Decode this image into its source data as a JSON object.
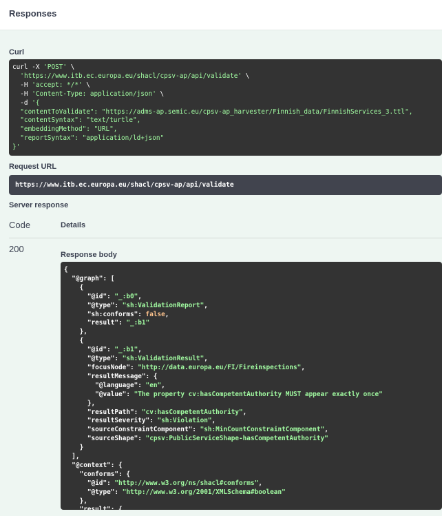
{
  "header": {
    "title": "Responses"
  },
  "curl": {
    "label": "Curl",
    "lines": [
      [
        [
          "plain",
          "curl -X "
        ],
        [
          "s",
          "'POST'"
        ],
        [
          "plain",
          " \\"
        ]
      ],
      [
        [
          "plain",
          "  "
        ],
        [
          "s",
          "'https://www.itb.ec.europa.eu/shacl/cpsv-ap/api/validate'"
        ],
        [
          "plain",
          " \\"
        ]
      ],
      [
        [
          "plain",
          "  -H "
        ],
        [
          "s",
          "'accept: */*'"
        ],
        [
          "plain",
          " \\"
        ]
      ],
      [
        [
          "plain",
          "  -H "
        ],
        [
          "s",
          "'Content-Type: application/json'"
        ],
        [
          "plain",
          " \\"
        ]
      ],
      [
        [
          "plain",
          "  -d "
        ],
        [
          "s",
          "'{"
        ]
      ],
      [
        [
          "s",
          "  \"contentToValidate\": \"https://adms-ap.semic.eu/cpsv-ap_harvester/Finnish_data/FinnishServices_3.ttl\","
        ]
      ],
      [
        [
          "s",
          "  \"contentSyntax\": \"text/turtle\","
        ]
      ],
      [
        [
          "s",
          "  \"embeddingMethod\": \"URL\","
        ]
      ],
      [
        [
          "s",
          "  \"reportSyntax\": \"application/ld+json\""
        ]
      ],
      [
        [
          "s",
          "}'"
        ]
      ]
    ]
  },
  "request_url": {
    "label": "Request URL",
    "value": "https://www.itb.ec.europa.eu/shacl/cpsv-ap/api/validate"
  },
  "server_response": {
    "label": "Server response",
    "code_header": "Code",
    "details_header": "Details",
    "code": "200",
    "body_label": "Response body",
    "body_lines": [
      [
        [
          "plain",
          "{"
        ]
      ],
      [
        [
          "plain",
          "  "
        ],
        [
          "k",
          "\"@graph\""
        ],
        [
          "plain",
          ": ["
        ]
      ],
      [
        [
          "plain",
          "    {"
        ]
      ],
      [
        [
          "plain",
          "      "
        ],
        [
          "k",
          "\"@id\""
        ],
        [
          "plain",
          ": "
        ],
        [
          "s",
          "\"_:b0\""
        ],
        [
          "plain",
          ","
        ]
      ],
      [
        [
          "plain",
          "      "
        ],
        [
          "k",
          "\"@type\""
        ],
        [
          "plain",
          ": "
        ],
        [
          "s",
          "\"sh:ValidationReport\""
        ],
        [
          "plain",
          ","
        ]
      ],
      [
        [
          "plain",
          "      "
        ],
        [
          "k",
          "\"sh:conforms\""
        ],
        [
          "plain",
          ": "
        ],
        [
          "bool",
          "false"
        ],
        [
          "plain",
          ","
        ]
      ],
      [
        [
          "plain",
          "      "
        ],
        [
          "k",
          "\"result\""
        ],
        [
          "plain",
          ": "
        ],
        [
          "s",
          "\"_:b1\""
        ]
      ],
      [
        [
          "plain",
          "    },"
        ]
      ],
      [
        [
          "plain",
          "    {"
        ]
      ],
      [
        [
          "plain",
          "      "
        ],
        [
          "k",
          "\"@id\""
        ],
        [
          "plain",
          ": "
        ],
        [
          "s",
          "\"_:b1\""
        ],
        [
          "plain",
          ","
        ]
      ],
      [
        [
          "plain",
          "      "
        ],
        [
          "k",
          "\"@type\""
        ],
        [
          "plain",
          ": "
        ],
        [
          "s",
          "\"sh:ValidationResult\""
        ],
        [
          "plain",
          ","
        ]
      ],
      [
        [
          "plain",
          "      "
        ],
        [
          "k",
          "\"focusNode\""
        ],
        [
          "plain",
          ": "
        ],
        [
          "s",
          "\"http://data.europa.eu/FI/Fireinspections\""
        ],
        [
          "plain",
          ","
        ]
      ],
      [
        [
          "plain",
          "      "
        ],
        [
          "k",
          "\"resultMessage\""
        ],
        [
          "plain",
          ": {"
        ]
      ],
      [
        [
          "plain",
          "        "
        ],
        [
          "k",
          "\"@language\""
        ],
        [
          "plain",
          ": "
        ],
        [
          "s",
          "\"en\""
        ],
        [
          "plain",
          ","
        ]
      ],
      [
        [
          "plain",
          "        "
        ],
        [
          "k",
          "\"@value\""
        ],
        [
          "plain",
          ": "
        ],
        [
          "s",
          "\"The property cv:hasCompetentAuthority MUST appear exactly once\""
        ]
      ],
      [
        [
          "plain",
          "      },"
        ]
      ],
      [
        [
          "plain",
          "      "
        ],
        [
          "k",
          "\"resultPath\""
        ],
        [
          "plain",
          ": "
        ],
        [
          "s",
          "\"cv:hasCompetentAuthority\""
        ],
        [
          "plain",
          ","
        ]
      ],
      [
        [
          "plain",
          "      "
        ],
        [
          "k",
          "\"resultSeverity\""
        ],
        [
          "plain",
          ": "
        ],
        [
          "s",
          "\"sh:Violation\""
        ],
        [
          "plain",
          ","
        ]
      ],
      [
        [
          "plain",
          "      "
        ],
        [
          "k",
          "\"sourceConstraintComponent\""
        ],
        [
          "plain",
          ": "
        ],
        [
          "s",
          "\"sh:MinCountConstraintComponent\""
        ],
        [
          "plain",
          ","
        ]
      ],
      [
        [
          "plain",
          "      "
        ],
        [
          "k",
          "\"sourceShape\""
        ],
        [
          "plain",
          ": "
        ],
        [
          "s",
          "\"cpsv:PublicServiceShape-hasCompetentAuthority\""
        ]
      ],
      [
        [
          "plain",
          "    }"
        ]
      ],
      [
        [
          "plain",
          "  ],"
        ]
      ],
      [
        [
          "plain",
          "  "
        ],
        [
          "k",
          "\"@context\""
        ],
        [
          "plain",
          ": {"
        ]
      ],
      [
        [
          "plain",
          "    "
        ],
        [
          "k",
          "\"conforms\""
        ],
        [
          "plain",
          ": {"
        ]
      ],
      [
        [
          "plain",
          "      "
        ],
        [
          "k",
          "\"@id\""
        ],
        [
          "plain",
          ": "
        ],
        [
          "s",
          "\"http://www.w3.org/ns/shacl#conforms\""
        ],
        [
          "plain",
          ","
        ]
      ],
      [
        [
          "plain",
          "      "
        ],
        [
          "k",
          "\"@type\""
        ],
        [
          "plain",
          ": "
        ],
        [
          "s",
          "\"http://www.w3.org/2001/XMLSchema#boolean\""
        ]
      ],
      [
        [
          "plain",
          "    },"
        ]
      ],
      [
        [
          "plain",
          "    "
        ],
        [
          "k",
          "\"result\""
        ],
        [
          "plain",
          ": {"
        ]
      ]
    ]
  }
}
